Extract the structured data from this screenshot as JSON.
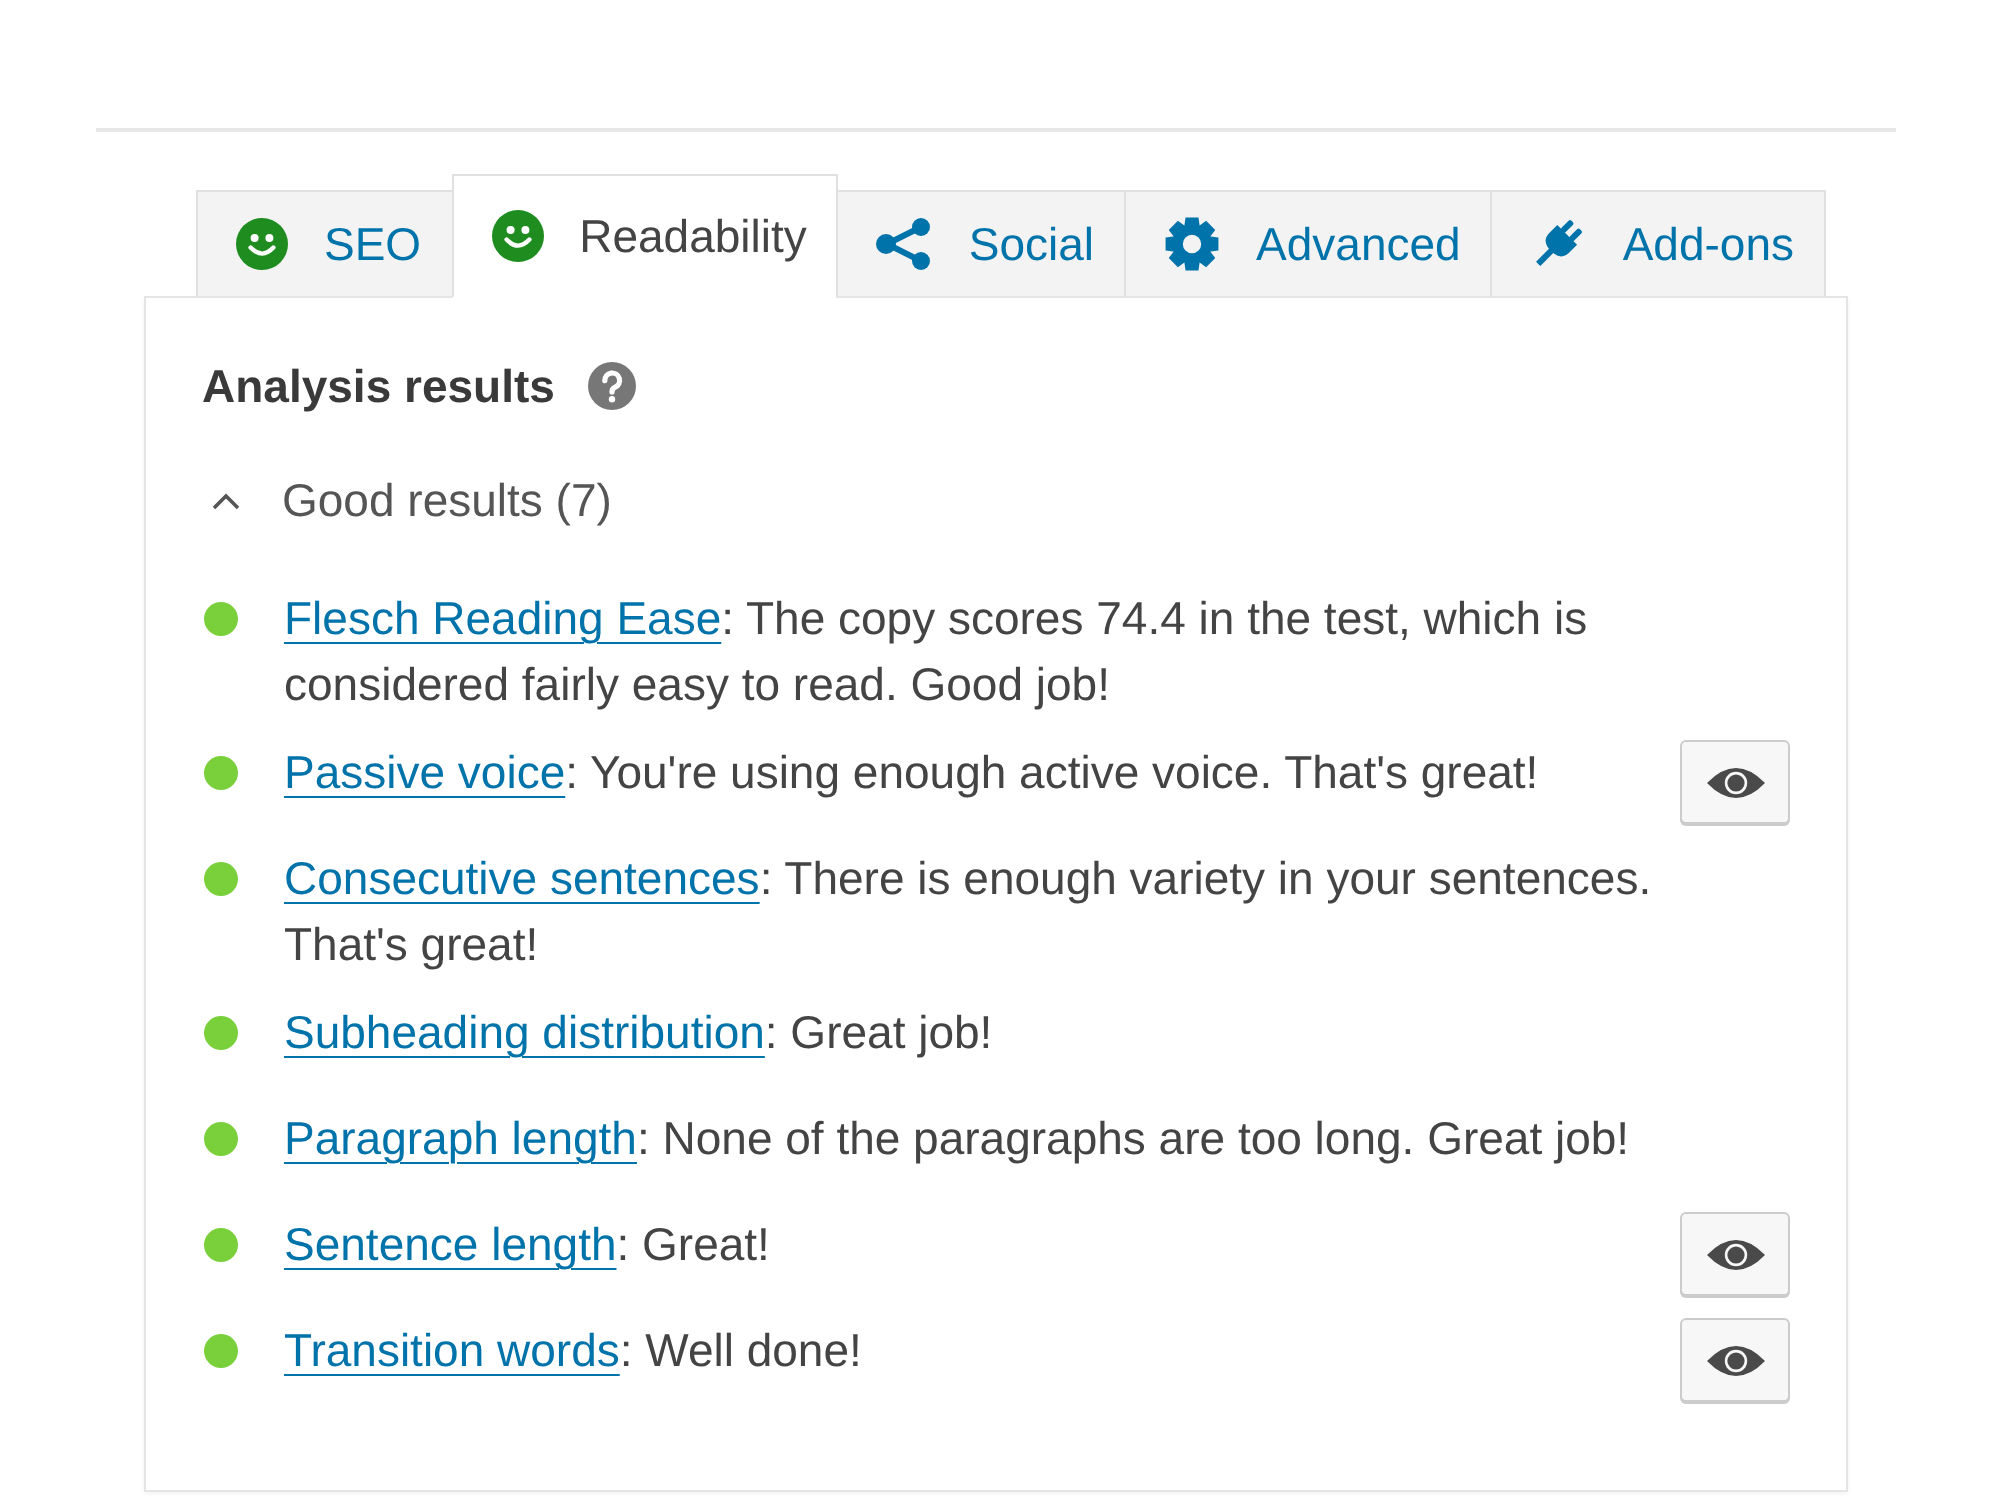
{
  "tabs": [
    {
      "label": "SEO",
      "kind": "smiley",
      "selected": false
    },
    {
      "label": "Readability",
      "kind": "smiley",
      "selected": true
    },
    {
      "label": "Social",
      "kind": "share",
      "selected": false
    },
    {
      "label": "Advanced",
      "kind": "gear",
      "selected": false
    },
    {
      "label": "Add-ons",
      "kind": "plug",
      "selected": false
    }
  ],
  "analysis": {
    "heading": "Analysis results",
    "group": {
      "label": "Good results (7)",
      "expanded": true,
      "items": [
        {
          "color": "#7ad03a",
          "link": "Flesch Reading Ease",
          "text": ": The copy scores 74.4 in the test, which is considered fairly easy to read. Good job!",
          "marker_button": false
        },
        {
          "color": "#7ad03a",
          "link": "Passive voice",
          "text": ": You're using enough active voice. That's great!",
          "marker_button": true
        },
        {
          "color": "#7ad03a",
          "link": "Consecutive sentences",
          "text": ": There is enough variety in your sentences. That's great!",
          "marker_button": false
        },
        {
          "color": "#7ad03a",
          "link": "Subheading distribution",
          "text": ": Great job!",
          "marker_button": false
        },
        {
          "color": "#7ad03a",
          "link": "Paragraph length",
          "text": ": None of the paragraphs are too long. Great job!",
          "marker_button": false
        },
        {
          "color": "#7ad03a",
          "link": "Sentence length",
          "text": ": Great!",
          "marker_button": true
        },
        {
          "color": "#7ad03a",
          "link": "Transition words",
          "text": ": Well done!",
          "marker_button": true
        }
      ]
    }
  }
}
